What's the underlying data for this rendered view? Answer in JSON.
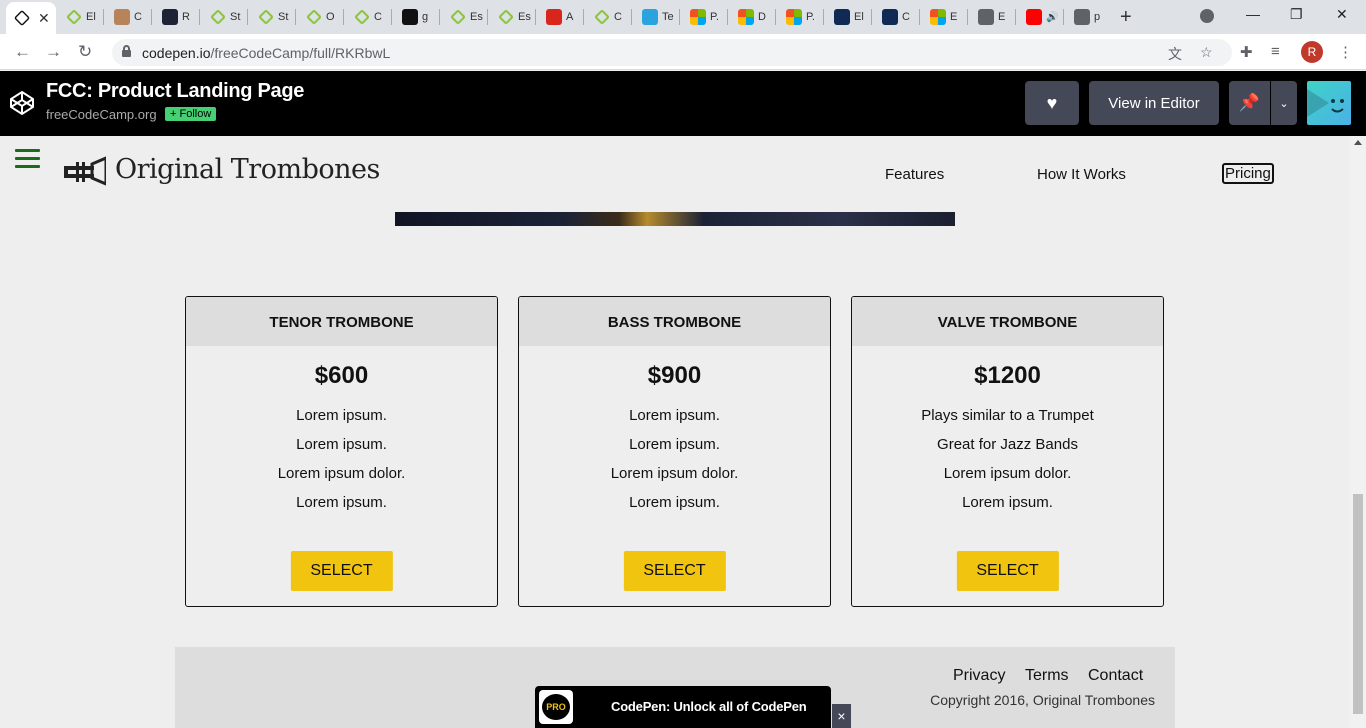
{
  "browser": {
    "tabs": [
      {
        "label": "",
        "favicon": "codepen-icon",
        "active": true
      },
      {
        "label": "El",
        "favicon": "green-diamond-icon"
      },
      {
        "label": "C",
        "favicon": "person-icon"
      },
      {
        "label": "R",
        "favicon": "dark-logo-icon"
      },
      {
        "label": "St",
        "favicon": "green-diamond-icon"
      },
      {
        "label": "St",
        "favicon": "green-diamond-icon"
      },
      {
        "label": "O",
        "favicon": "green-diamond-icon"
      },
      {
        "label": "C",
        "favicon": "green-diamond-icon"
      },
      {
        "label": "g",
        "favicon": "github-icon"
      },
      {
        "label": "Es",
        "favicon": "green-diamond-icon"
      },
      {
        "label": "Es",
        "favicon": "green-diamond-icon"
      },
      {
        "label": "A",
        "favicon": "red-code-icon"
      },
      {
        "label": "C",
        "favicon": "green-diamond-icon"
      },
      {
        "label": "Te",
        "favicon": "telegram-icon"
      },
      {
        "label": "P.",
        "favicon": "microsoft-icon"
      },
      {
        "label": "D",
        "favicon": "microsoft-icon"
      },
      {
        "label": "P.",
        "favicon": "microsoft-icon"
      },
      {
        "label": "El",
        "favicon": "data-icon"
      },
      {
        "label": "C",
        "favicon": "data-icon"
      },
      {
        "label": "E",
        "favicon": "microsoft-icon"
      },
      {
        "label": "E",
        "favicon": "globe-icon"
      },
      {
        "label": "",
        "favicon": "youtube-icon"
      },
      {
        "label": "p",
        "favicon": "globe-icon"
      }
    ],
    "new_tab": "+",
    "url_host": "codepen.io",
    "url_path": "/freeCodeCamp/full/RKRbwL",
    "profile_initial": "R"
  },
  "codepen": {
    "title": "FCC: Product Landing Page",
    "author": "freeCodeCamp.org",
    "follow_label": "+ Follow",
    "view_editor_label": "View in Editor"
  },
  "site": {
    "brand": "Original Trombones",
    "nav": {
      "features": "Features",
      "how": "How It Works",
      "pricing": "Pricing"
    },
    "cards": [
      {
        "title": "TENOR TROMBONE",
        "price": "$600",
        "items": [
          "Lorem ipsum.",
          "Lorem ipsum.",
          "Lorem ipsum dolor.",
          "Lorem ipsum."
        ],
        "button": "SELECT"
      },
      {
        "title": "BASS TROMBONE",
        "price": "$900",
        "items": [
          "Lorem ipsum.",
          "Lorem ipsum.",
          "Lorem ipsum dolor.",
          "Lorem ipsum."
        ],
        "button": "SELECT"
      },
      {
        "title": "VALVE TROMBONE",
        "price": "$1200",
        "items": [
          "Plays similar to a Trumpet",
          "Great for Jazz Bands",
          "Lorem ipsum dolor.",
          "Lorem ipsum."
        ],
        "button": "SELECT"
      }
    ],
    "footer": {
      "privacy": "Privacy",
      "terms": "Terms",
      "contact": "Contact",
      "copyright": "Copyright 2016, Original Trombones"
    }
  },
  "pro_popup": {
    "badge": "PRO",
    "text": "CodePen: Unlock all of CodePen",
    "close": "×"
  },
  "colors": {
    "accent_yellow": "#f1c40f",
    "hamburger_green": "#1b6b1b",
    "follow_green": "#47cf73"
  }
}
